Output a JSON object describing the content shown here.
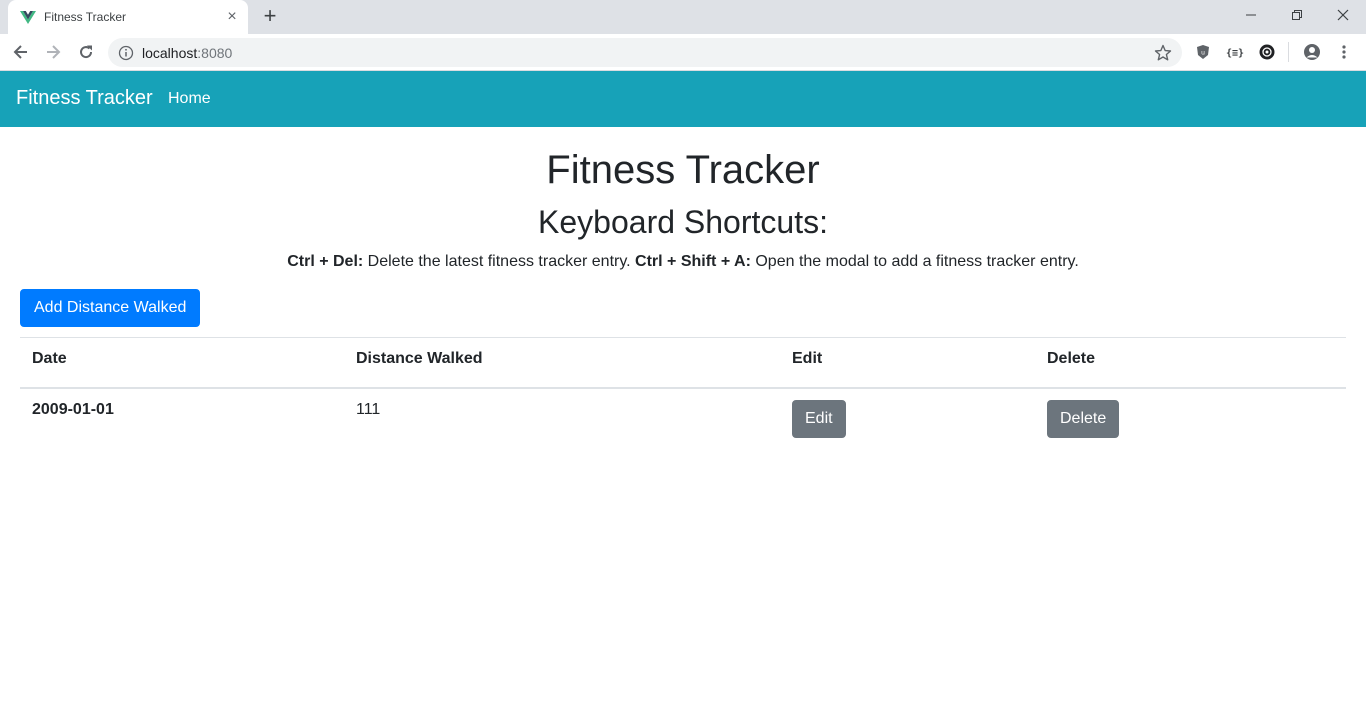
{
  "browser": {
    "tab": {
      "title": "Fitness Tracker",
      "favicon_icon": "vue-logo-icon",
      "close_label": "×"
    },
    "new_tab_label": "+",
    "url": {
      "host": "localhost",
      "port": ":8080"
    },
    "icons": {
      "back": "arrow-left-icon",
      "forward": "arrow-right-icon",
      "reload": "reload-icon",
      "info": "info-icon",
      "bookmark": "star-icon",
      "extensions": [
        "shield-extension-icon",
        "json-extension-icon",
        "dark-extension-icon"
      ],
      "profile": "profile-icon",
      "menu": "kebab-menu-icon"
    }
  },
  "navbar": {
    "brand": "Fitness Tracker",
    "links": [
      {
        "label": "Home"
      }
    ],
    "color": "#17a2b8"
  },
  "main": {
    "title": "Fitness Tracker",
    "subtitle": "Keyboard Shortcuts:",
    "shortcuts": [
      {
        "keys": "Ctrl + Del:",
        "description": " Delete the latest fitness tracker entry."
      },
      {
        "keys": "Ctrl + Shift + A:",
        "description": " Open the modal to add a fitness tracker entry."
      }
    ],
    "add_button": "Add Distance Walked",
    "table": {
      "headers": [
        "Date",
        "Distance Walked",
        "Edit",
        "Delete"
      ],
      "rows": [
        {
          "date": "2009-01-01",
          "distance": "111",
          "edit_label": "Edit",
          "delete_label": "Delete"
        }
      ]
    }
  },
  "colors": {
    "primary": "#007bff",
    "secondary": "#6c757d",
    "info": "#17a2b8"
  }
}
